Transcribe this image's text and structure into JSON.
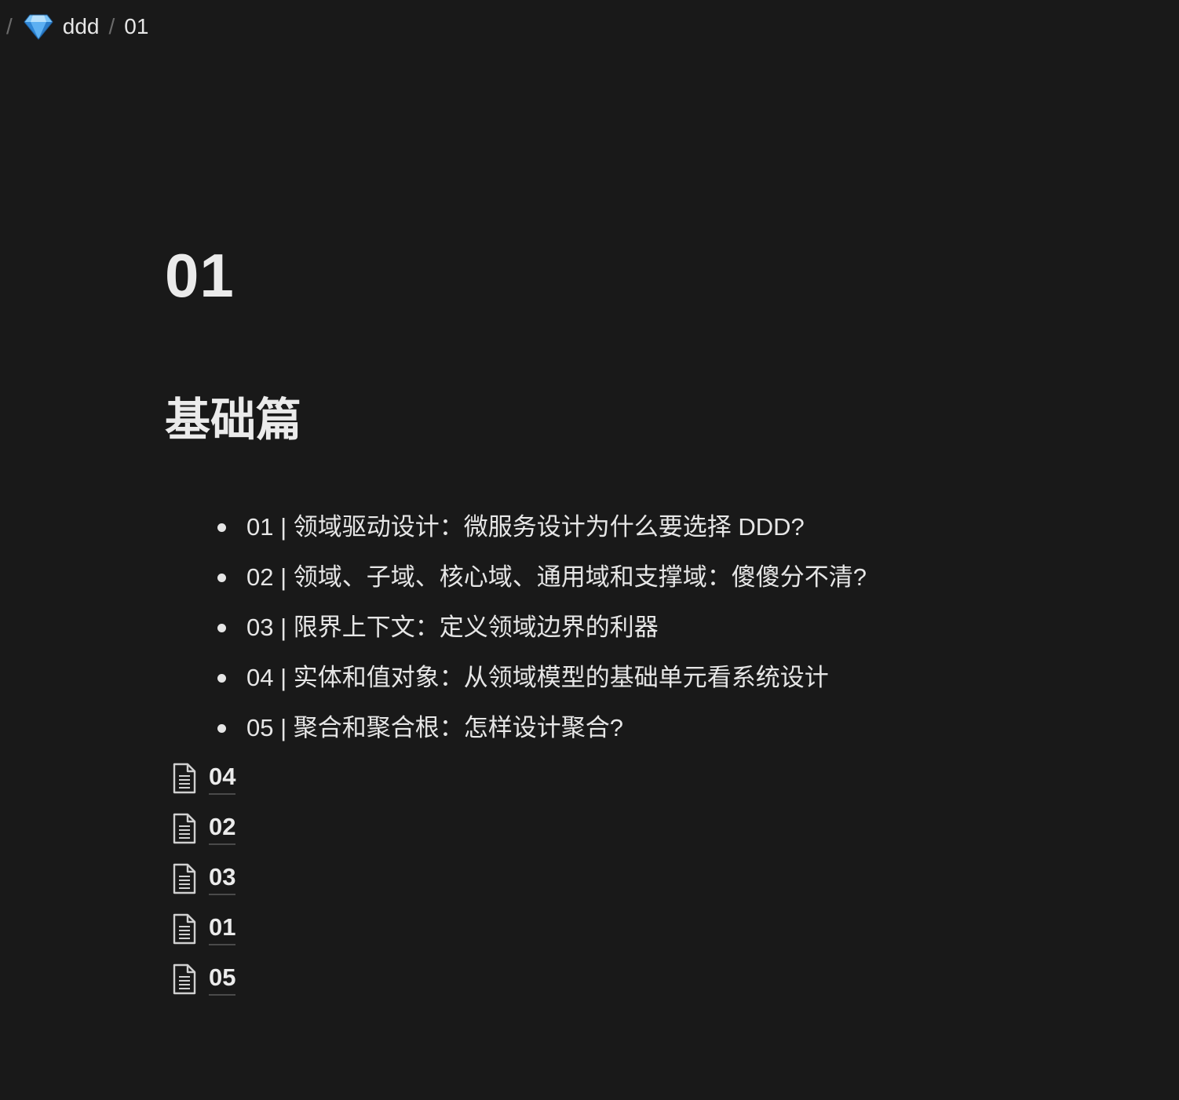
{
  "breadcrumb": {
    "root_separator": "/",
    "separator": "/",
    "workspace": {
      "label": "ddd",
      "icon": "gem-icon"
    },
    "current": {
      "label": "01"
    }
  },
  "page": {
    "title": "01",
    "section_heading": "基础篇"
  },
  "toc": {
    "items": [
      {
        "label": "01 | 领域驱动设计：微服务设计为什么要选择 DDD?"
      },
      {
        "label": "02 | 领域、子域、核心域、通用域和支撑域：傻傻分不清?"
      },
      {
        "label": "03 | 限界上下文：定义领域边界的利器"
      },
      {
        "label": "04 | 实体和值对象：从领域模型的基础单元看系统设计"
      },
      {
        "label": "05 | 聚合和聚合根：怎样设计聚合?"
      }
    ]
  },
  "page_links": {
    "icon": "document-icon",
    "items": [
      {
        "label": "04"
      },
      {
        "label": "02"
      },
      {
        "label": "03"
      },
      {
        "label": "01"
      },
      {
        "label": "05"
      }
    ]
  },
  "colors": {
    "background": "#191919",
    "text": "#e6e6e6",
    "separator": "#6b6b6b",
    "gem": "#4aa8f0"
  }
}
